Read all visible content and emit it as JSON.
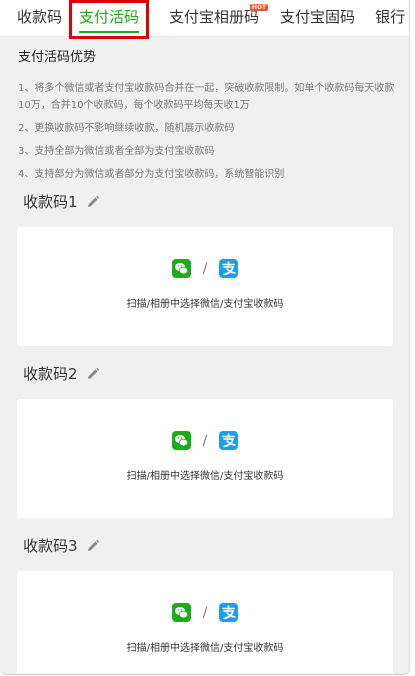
{
  "tabs": [
    {
      "label": "收款码",
      "active": false
    },
    {
      "label": "支付活码",
      "active": true
    },
    {
      "label": "支付宝相册码",
      "active": false,
      "badge": "HOT"
    },
    {
      "label": "支付宝固码",
      "active": false
    },
    {
      "label": "银行",
      "active": false
    }
  ],
  "advantages": {
    "title": "支付活码优势",
    "items": [
      "1、将多个微信或者支付宝收款码合并在一起，突破收款限制。如单个收款码每天收款10万，合并10个收款码，每个收款码平均每天收1万",
      "2、更换收款码不影响继续收款，随机展示收款码",
      "3、支持全部为微信或者全部为支付宝收款码",
      "4、支持部分为微信或者部分为支付宝收款码，系统智能识别"
    ]
  },
  "sections": [
    {
      "title": "收款码1",
      "separator": "/",
      "hint": "扫描/相册中选择微信/支付宝收款码"
    },
    {
      "title": "收款码2",
      "separator": "/",
      "hint": "扫描/相册中选择微信/支付宝收款码"
    },
    {
      "title": "收款码3",
      "separator": "/",
      "hint": "扫描/相册中选择微信/支付宝收款码"
    }
  ],
  "icons": {
    "edit": "pencil-icon",
    "wechat": "wechat-icon",
    "alipay": "alipay-icon"
  },
  "colors": {
    "accent": "#1aad19",
    "highlight": "#e00000",
    "wechat": "#1aad19",
    "alipay": "#1a9ff0",
    "hot_badge": "#ff4d2e"
  }
}
